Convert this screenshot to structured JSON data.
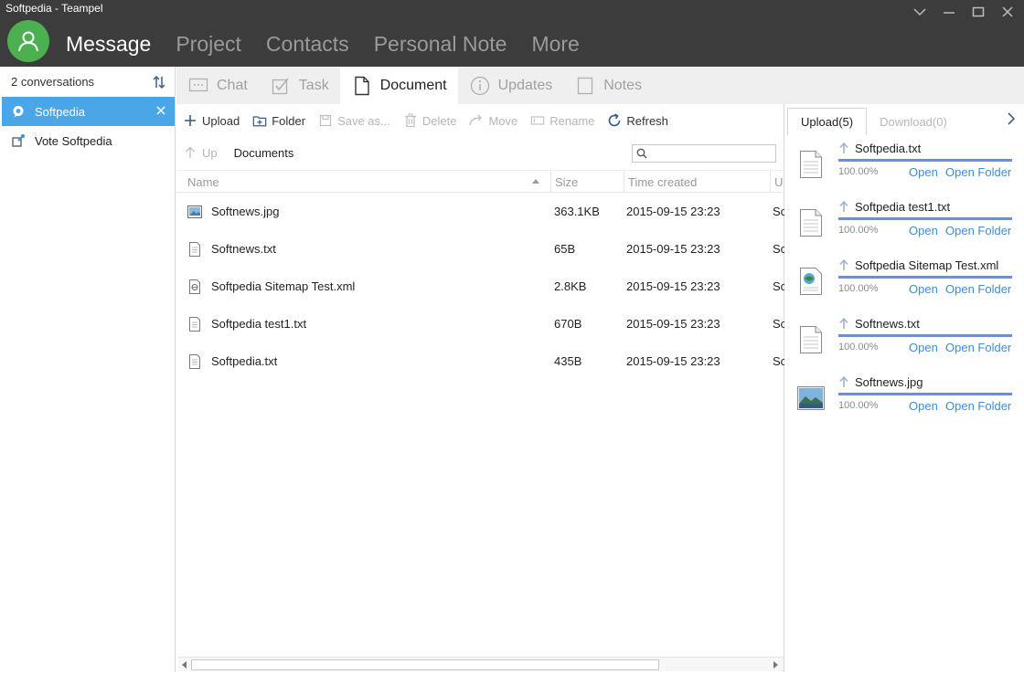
{
  "window": {
    "title": "Softpedia - Teampel"
  },
  "nav": {
    "items": [
      {
        "label": "Message",
        "active": true
      },
      {
        "label": "Project",
        "active": false
      },
      {
        "label": "Contacts",
        "active": false
      },
      {
        "label": "Personal Note",
        "active": false
      },
      {
        "label": "More",
        "active": false
      }
    ]
  },
  "sidebar": {
    "header": "2 conversations",
    "items": [
      {
        "label": "Softpedia",
        "icon": "chat-bubble-icon",
        "active": true
      },
      {
        "label": "Vote Softpedia",
        "icon": "vote-icon",
        "active": false
      }
    ]
  },
  "tabs": [
    {
      "label": "Chat",
      "icon": "chat-icon",
      "active": false
    },
    {
      "label": "Task",
      "icon": "task-icon",
      "active": false
    },
    {
      "label": "Document",
      "icon": "document-icon",
      "active": true
    },
    {
      "label": "Updates",
      "icon": "info-icon",
      "active": false
    },
    {
      "label": "Notes",
      "icon": "notes-icon",
      "active": false
    }
  ],
  "toolbar": {
    "upload": "Upload",
    "folder": "Folder",
    "save_as": "Save as...",
    "delete": "Delete",
    "move": "Move",
    "rename": "Rename",
    "refresh": "Refresh"
  },
  "path": {
    "up": "Up",
    "current": "Documents",
    "search_placeholder": ""
  },
  "table": {
    "columns": {
      "name": "Name",
      "size": "Size",
      "time": "Time created",
      "uploader": "U"
    },
    "rows": [
      {
        "name": "Softnews.jpg",
        "size": "363.1KB",
        "time": "2015-09-15 23:23",
        "uploader": "Sc",
        "icon": "image-file-icon"
      },
      {
        "name": "Softnews.txt",
        "size": "65B",
        "time": "2015-09-15 23:23",
        "uploader": "Sc",
        "icon": "text-file-icon"
      },
      {
        "name": "Softpedia Sitemap Test.xml",
        "size": "2.8KB",
        "time": "2015-09-15 23:23",
        "uploader": "Sc",
        "icon": "xml-file-icon"
      },
      {
        "name": "Softpedia test1.txt",
        "size": "670B",
        "time": "2015-09-15 23:23",
        "uploader": "Sc",
        "icon": "text-file-icon"
      },
      {
        "name": "Softpedia.txt",
        "size": "435B",
        "time": "2015-09-15 23:23",
        "uploader": "Sc",
        "icon": "text-file-icon"
      }
    ]
  },
  "transfers": {
    "upload_tab": "Upload(5)",
    "download_tab": "Download(0)",
    "open_label": "Open",
    "open_folder_label": "Open Folder",
    "items": [
      {
        "name": "Softpedia.txt",
        "percent": "100.00%",
        "progress": 1.0,
        "icon": "text-file-icon"
      },
      {
        "name": "Softpedia test1.txt",
        "percent": "100.00%",
        "progress": 1.0,
        "icon": "text-file-icon"
      },
      {
        "name": "Softpedia Sitemap Test.xml",
        "percent": "100.00%",
        "progress": 1.0,
        "icon": "xml-file-icon"
      },
      {
        "name": "Softnews.txt",
        "percent": "100.00%",
        "progress": 1.0,
        "icon": "text-file-icon"
      },
      {
        "name": "Softnews.jpg",
        "percent": "100.00%",
        "progress": 1.0,
        "icon": "image-file-icon"
      }
    ]
  },
  "colors": {
    "topbar": "#3c3c3c",
    "accent": "#4aa6e6",
    "avatar": "#4caf50",
    "link": "#3c8fd6",
    "progress": "#6b93c9"
  }
}
